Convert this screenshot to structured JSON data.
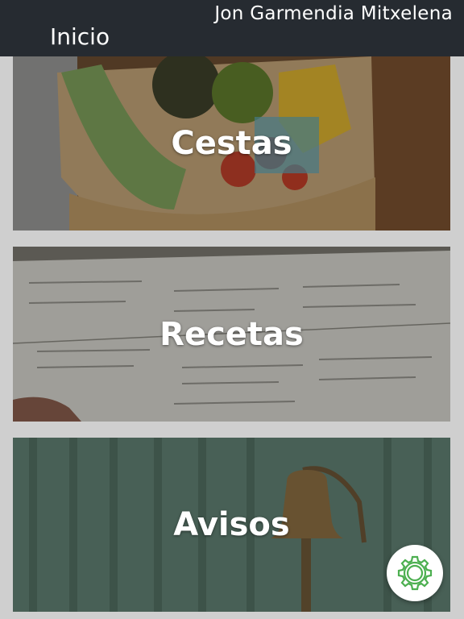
{
  "header": {
    "user_name": "Jon Garmendia Mitxelena",
    "title": "Inicio"
  },
  "cards": [
    {
      "label": "Cestas",
      "image": "vegetable-basket-photo"
    },
    {
      "label": "Recetas",
      "image": "menu-paper-photo"
    },
    {
      "label": "Avisos",
      "image": "wall-bell-photo"
    }
  ],
  "fab": {
    "icon": "settings-gear-icon",
    "color": "#4caf50"
  },
  "colors": {
    "topbar": "#262b31",
    "background": "#cfcfcf",
    "accent": "#4caf50"
  }
}
